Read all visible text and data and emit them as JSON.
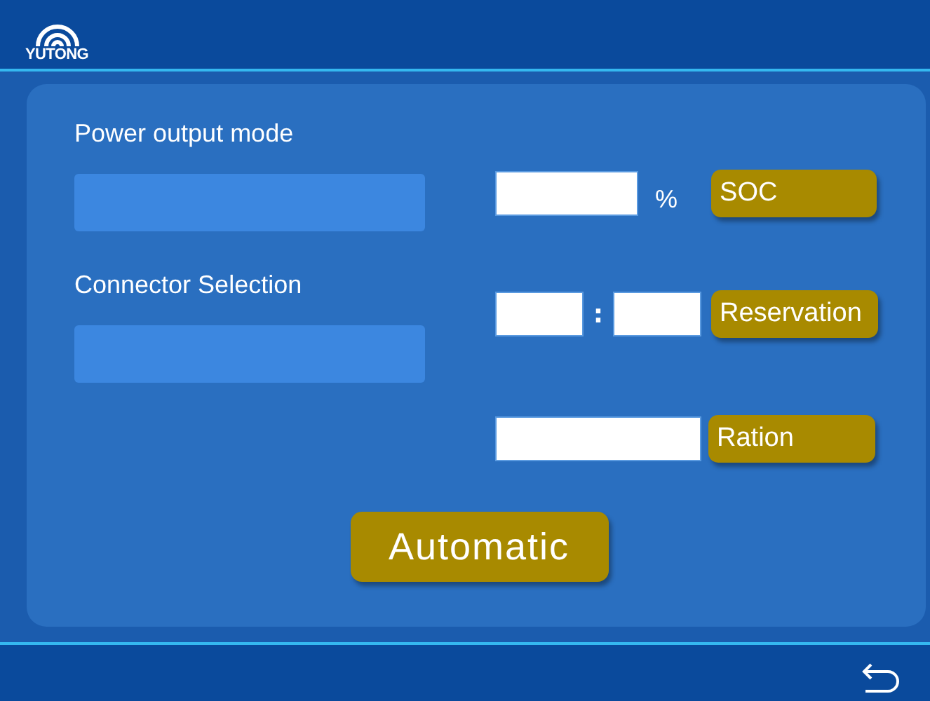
{
  "header": {
    "logo_text": "YUTONG"
  },
  "left_fields": [
    {
      "label": "Power output mode"
    },
    {
      "label": "Connector Selection"
    }
  ],
  "soc": {
    "unit": "%",
    "button": "SOC"
  },
  "reservation": {
    "separator": ":",
    "button": "Reservation"
  },
  "ration": {
    "button": "Ration"
  },
  "action_button": "Automatic"
}
